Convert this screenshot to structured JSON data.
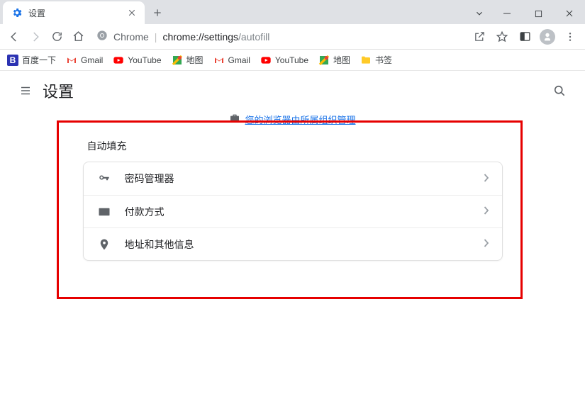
{
  "window": {
    "tab_title": "设置"
  },
  "address": {
    "chrome_label": "Chrome",
    "url_dark": "chrome://settings",
    "url_rest": "/autofill"
  },
  "bookmarks": {
    "items": [
      {
        "label": "百度一下"
      },
      {
        "label": "Gmail"
      },
      {
        "label": "YouTube"
      },
      {
        "label": "地图"
      },
      {
        "label": "Gmail"
      },
      {
        "label": "YouTube"
      },
      {
        "label": "地图"
      },
      {
        "label": "书签"
      }
    ]
  },
  "settings": {
    "header_title": "设置",
    "managed_text": "您的浏览器由所属组织管理",
    "section_title": "自动填充",
    "rows": {
      "passwords": "密码管理器",
      "payments": "付款方式",
      "addresses": "地址和其他信息"
    }
  }
}
